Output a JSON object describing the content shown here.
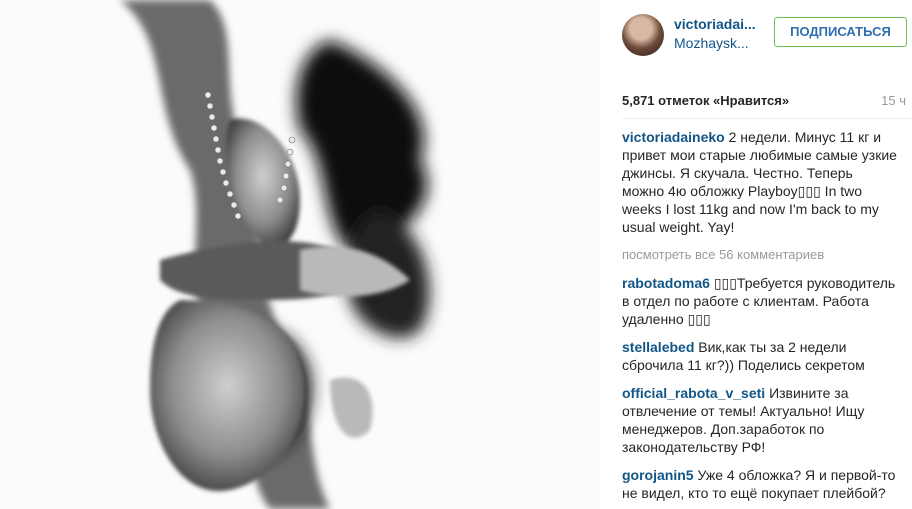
{
  "post": {
    "username": "victoriadai...",
    "location": "Mozhaysk...",
    "follow_label": "ПОДПИСАТЬСЯ",
    "likes": "5,871 отметок «Нравится»",
    "time_ago": "15 ч",
    "caption_user": "victoriadaineko",
    "caption_text": "2 недели. Минус 11 кг и привет мои старые любимые самые узкие джинсы. Я скучала. Честно. Теперь можно 4ю обложку Playboy▯▯▯ In two weeks I lost 11kg and now I'm back to my usual weight. Yay!",
    "view_all": "посмотреть все 56 комментариев"
  },
  "comments": [
    {
      "user": "rabotadoma6",
      "text": "▯▯▯Требуется руководитель в отдел по работе с клиентам. Работа удаленно ▯▯▯"
    },
    {
      "user": "stellalebed",
      "text": "Вик,как ты за 2 недели сброчила 11 кг?)) Поделись секретом"
    },
    {
      "user": "official_rabota_v_seti",
      "text": "Извините за отвлечение от темы! Актуально! Ищу менеджеров. Доп.заработок по законодательству РФ!"
    },
    {
      "user": "gorojanin5",
      "text": "Уже 4 обложка? Я и первой-то не видел, кто то ещё покупает плейбой?"
    }
  ],
  "colors": {
    "link": "#125688",
    "follow_border": "#70c050",
    "muted": "#9a9a9a"
  }
}
